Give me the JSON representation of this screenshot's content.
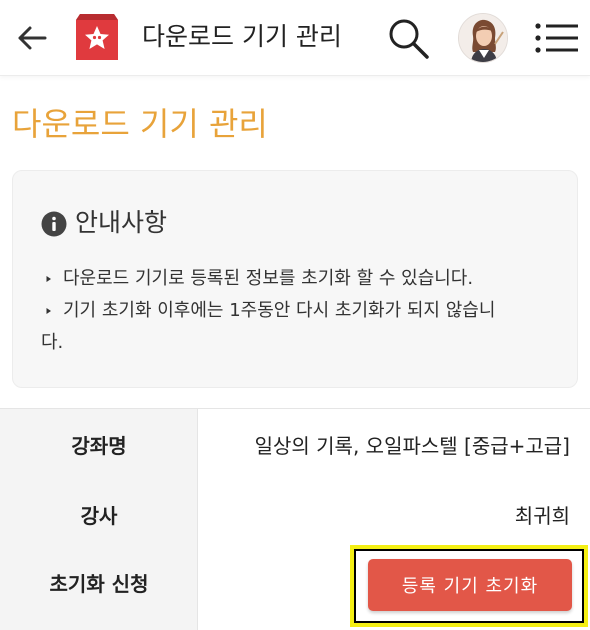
{
  "appbar": {
    "title": "다운로드 기기 관리",
    "icons": [
      "back-arrow-icon",
      "app-logo",
      "search-icon",
      "avatar",
      "menu-icon"
    ],
    "accent_logo_color": "#e03a3e"
  },
  "page": {
    "heading": "다운로드 기기 관리",
    "heading_color": "#e8a33a"
  },
  "notice": {
    "title": "안내사항",
    "items": [
      "다운로드 기기로 등록된 정보를 초기화 할 수 있습니다.",
      "기기 초기화 이후에는 1주동안 다시 초기화가 되지 않습니"
    ],
    "item_2_wrap": "다."
  },
  "details": {
    "rows": [
      {
        "label": "강좌명",
        "value": "일상의 기록, 오일파스텔 [중급+고급]"
      },
      {
        "label": "강사",
        "value": "최귀희"
      },
      {
        "label": "초기화 신청"
      }
    ],
    "reset_button_label": "등록 기기 초기화",
    "reset_button_color": "#e25748",
    "highlight_color": "#f4ef14"
  }
}
